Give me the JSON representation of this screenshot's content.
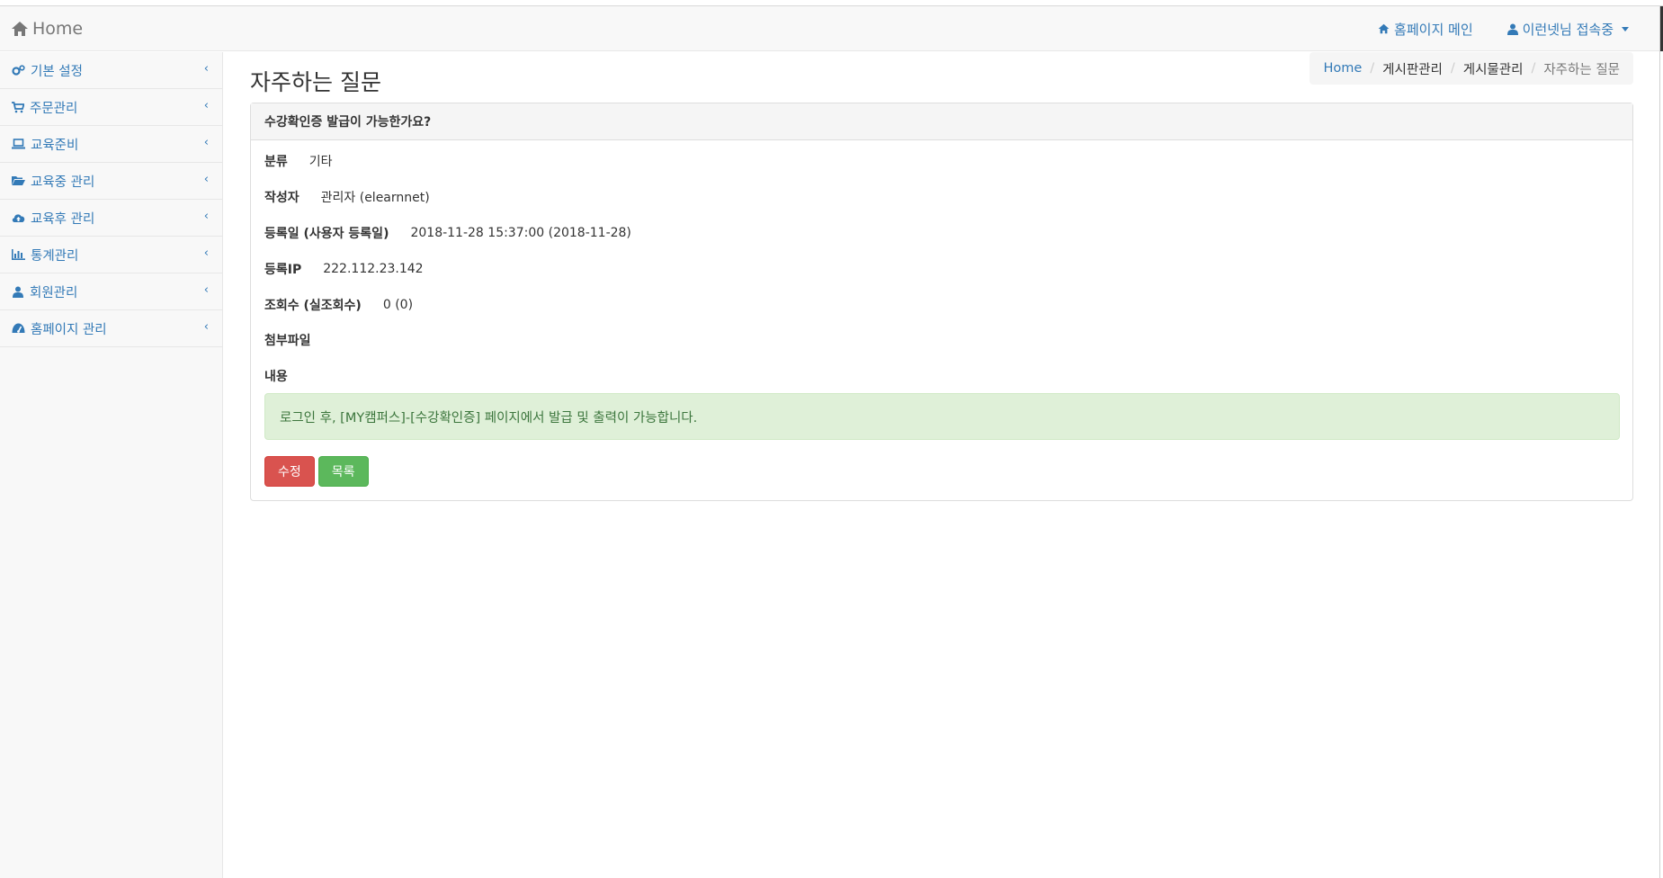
{
  "navbar": {
    "brand": "Home",
    "links": [
      {
        "label": "홈페이지 메인",
        "icon": "home-icon"
      },
      {
        "label": "이런넷님 접속중",
        "icon": "user-icon"
      }
    ]
  },
  "sidebar": {
    "items": [
      {
        "label": "기본 설정",
        "icon": "gears-icon"
      },
      {
        "label": "주문관리",
        "icon": "cart-icon"
      },
      {
        "label": "교육준비",
        "icon": "laptop-icon"
      },
      {
        "label": "교육중 관리",
        "icon": "folder-open-icon"
      },
      {
        "label": "교육후 관리",
        "icon": "cloud-upload-icon"
      },
      {
        "label": "통계관리",
        "icon": "bar-chart-icon"
      },
      {
        "label": "회원관리",
        "icon": "user-icon"
      },
      {
        "label": "홈페이지 관리",
        "icon": "dashboard-icon"
      }
    ],
    "chevron": "‹"
  },
  "page": {
    "title": "자주하는 질문",
    "breadcrumb": [
      "Home",
      "게시판관리",
      "게시물관리",
      "자주하는 질문"
    ]
  },
  "panel": {
    "heading": "수강확인증 발급이 가능한가요?",
    "fields": [
      {
        "label": "분류",
        "value": "기타"
      },
      {
        "label": "작성자",
        "value": "관리자 (elearnnet)"
      },
      {
        "label": "등록일 (사용자 등록일)",
        "value": "2018-11-28 15:37:00 (2018-11-28)"
      },
      {
        "label": "등록IP",
        "value": "222.112.23.142"
      },
      {
        "label": "조회수 (실조회수)",
        "value": "0 (0)"
      },
      {
        "label": "첨부파일",
        "value": ""
      },
      {
        "label": "내용",
        "value": ""
      }
    ],
    "content": "로그인 후, [MY캠퍼스]-[수강확인증] 페이지에서 발급 및 출력이 가능합니다.",
    "buttons": {
      "edit": "수정",
      "list": "목록"
    }
  },
  "colors": {
    "link": "#337ab7",
    "danger": "#d9534f",
    "success": "#5cb85c",
    "alert_bg": "#dff0d8",
    "alert_text": "#3c763d"
  }
}
